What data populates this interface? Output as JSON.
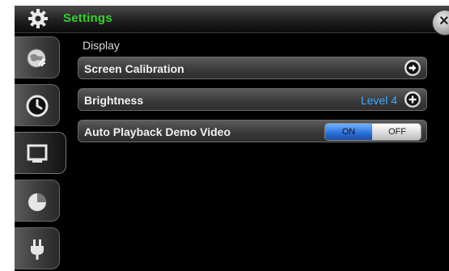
{
  "app": {
    "title": "Settings"
  },
  "sidebar": {
    "tabs": [
      {
        "name": "network",
        "icon": "globe-wifi-icon",
        "active": false
      },
      {
        "name": "clock",
        "icon": "clock-icon",
        "active": false
      },
      {
        "name": "display",
        "icon": "monitor-icon",
        "active": true
      },
      {
        "name": "storage",
        "icon": "pie-chart-icon",
        "active": false
      },
      {
        "name": "power",
        "icon": "power-plug-icon",
        "active": false
      }
    ]
  },
  "main": {
    "section_title": "Display",
    "rows": {
      "screen_calibration": {
        "label": "Screen Calibration",
        "icon": "arrow-right-icon"
      },
      "brightness": {
        "label": "Brightness",
        "value": "Level 4",
        "icon": "plus-icon"
      },
      "auto_playback": {
        "label": "Auto Playback Demo Video",
        "on_label": "ON",
        "off_label": "OFF",
        "selected": "ON"
      }
    }
  },
  "colors": {
    "title": "#36d22a",
    "accent_blue": "#3fa9ff",
    "toggle_on": "#2a6fd6"
  }
}
